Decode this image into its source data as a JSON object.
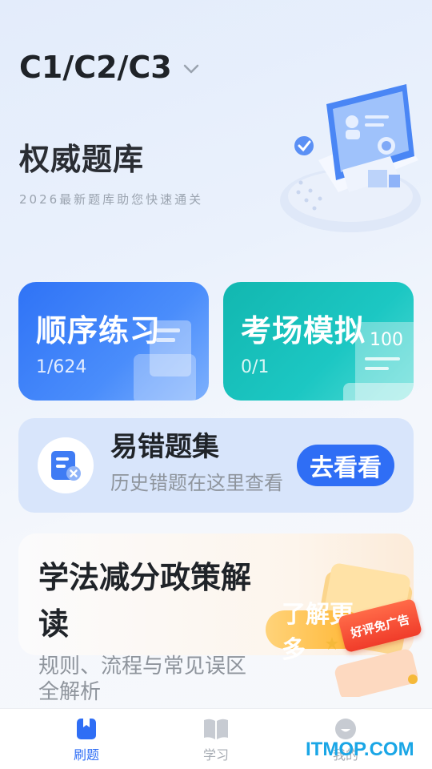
{
  "header": {
    "license_type": "C1/C2/C3",
    "title": "权威题库",
    "subtitle": "2026最新题库助您快速通关"
  },
  "cards": {
    "sequential": {
      "title": "顺序练习",
      "progress": "1/624"
    },
    "exam": {
      "title": "考场模拟",
      "progress": "0/1",
      "badge": "100"
    }
  },
  "wrong_questions": {
    "title": "易错题集",
    "subtitle": "历史错题在这里查看",
    "button": "去看看"
  },
  "policy": {
    "title": "学法减分政策解读",
    "subtitle": "规则、流程与常见误区全解析",
    "button": "了解更多",
    "tag": "好评免广告"
  },
  "tabbar": {
    "items": [
      {
        "label": "刷题",
        "active": true
      },
      {
        "label": "学习",
        "active": false
      },
      {
        "label": "我的",
        "active": false
      }
    ]
  },
  "watermark": "ITMOP.COM",
  "colors": {
    "primary": "#2f6ef5",
    "teal": "#1cc7c3",
    "orange": "#ffb531",
    "red": "#f03c2a"
  }
}
